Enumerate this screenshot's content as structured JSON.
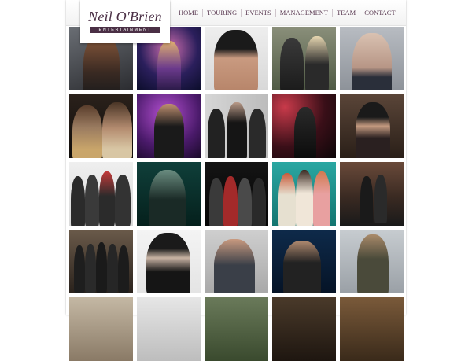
{
  "brand": {
    "name": "Neil O'Brien",
    "tagline": "ENTERTAINMENT"
  },
  "nav": {
    "items": [
      {
        "label": "HOME"
      },
      {
        "label": "TOURING"
      },
      {
        "label": "EVENTS"
      },
      {
        "label": "MANAGEMENT"
      },
      {
        "label": "TEAM"
      },
      {
        "label": "CONTACT"
      }
    ]
  },
  "colors": {
    "brand_accent": "#4a2f45",
    "nav_text": "#5a3a52"
  },
  "artist_grid": {
    "tile_count": 25
  }
}
